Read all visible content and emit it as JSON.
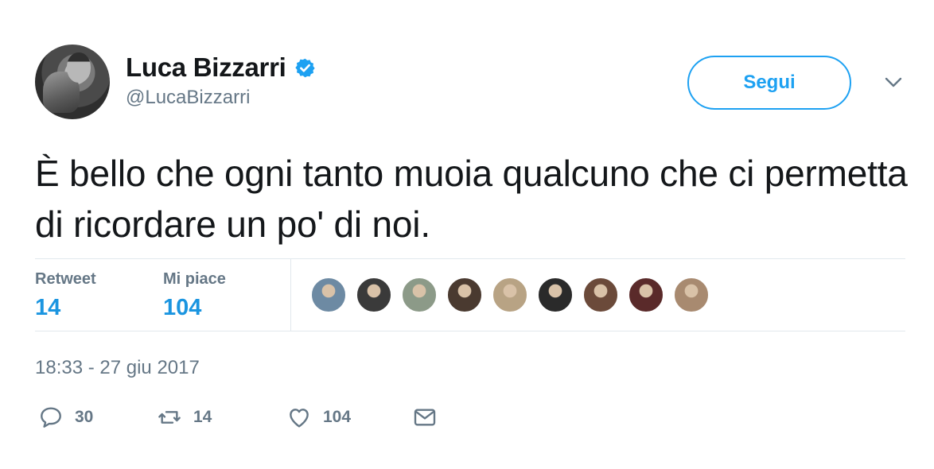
{
  "user": {
    "display_name": "Luca Bizzarri",
    "handle": "@LucaBizzarri",
    "verified_icon": "verified-badge-icon",
    "avatar_icon": "avatar"
  },
  "follow_button": {
    "label": "Segui"
  },
  "menu": {
    "icon": "chevron-down-icon"
  },
  "tweet": {
    "text": "È bello che ogni tanto muoia qualcuno che ci permetta di ricordare un po' di noi."
  },
  "stats": {
    "retweets": {
      "label": "Retweet",
      "value": "14"
    },
    "likes": {
      "label": "Mi piace",
      "value": "104"
    }
  },
  "likers": [
    {
      "name": "liker-avatar-1",
      "color": "#6d8aa3"
    },
    {
      "name": "liker-avatar-2",
      "color": "#3a3a3a"
    },
    {
      "name": "liker-avatar-3",
      "color": "#8c9a88"
    },
    {
      "name": "liker-avatar-4",
      "color": "#4a3a30"
    },
    {
      "name": "liker-avatar-5",
      "color": "#b8a384"
    },
    {
      "name": "liker-avatar-6",
      "color": "#2a2a2a"
    },
    {
      "name": "liker-avatar-7",
      "color": "#6b4a3a"
    },
    {
      "name": "liker-avatar-8",
      "color": "#5a2a2a"
    },
    {
      "name": "liker-avatar-9",
      "color": "#a88a70"
    }
  ],
  "timestamp": "18:33 - 27 giu 2017",
  "actions": {
    "reply": {
      "icon": "reply-icon",
      "count": "30"
    },
    "retweet": {
      "icon": "retweet-icon",
      "count": "14"
    },
    "like": {
      "icon": "heart-icon",
      "count": "104"
    },
    "message": {
      "icon": "envelope-icon"
    }
  },
  "colors": {
    "accent": "#1da1f2",
    "stat_value": "#1b95e0",
    "secondary_text": "#657786",
    "divider": "#e1e8ed"
  }
}
